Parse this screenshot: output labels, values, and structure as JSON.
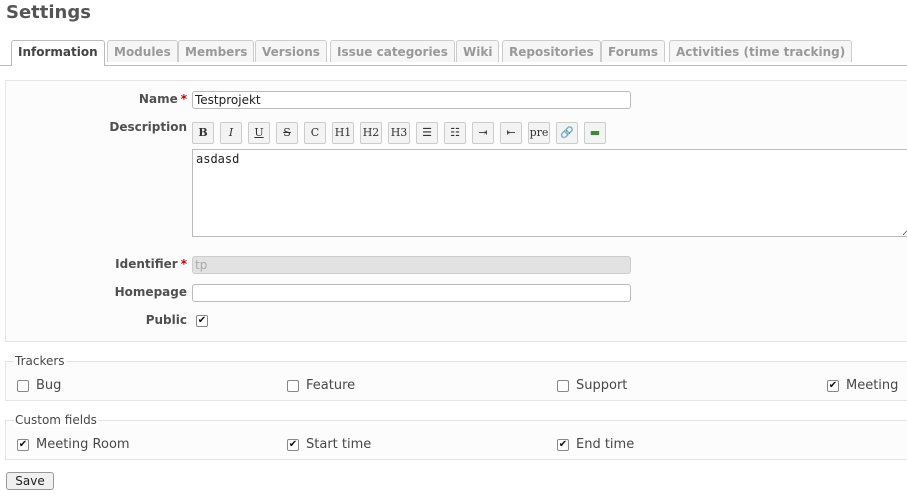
{
  "page": {
    "title": "Settings"
  },
  "tabs": [
    {
      "label": "Information",
      "active": true
    },
    {
      "label": "Modules"
    },
    {
      "label": "Members"
    },
    {
      "label": "Versions"
    },
    {
      "label": "Issue categories"
    },
    {
      "label": "Wiki"
    },
    {
      "label": "Repositories"
    },
    {
      "label": "Forums"
    },
    {
      "label": "Activities (time tracking)"
    }
  ],
  "form": {
    "name_label": "Name",
    "name_value": "Testprojekt",
    "required_mark": "*",
    "description_label": "Description",
    "description_value": "asdasd",
    "identifier_label": "Identifier",
    "identifier_value": "tp",
    "homepage_label": "Homepage",
    "homepage_value": "",
    "public_label": "Public",
    "public_checked": true
  },
  "toolbar": {
    "buttons": [
      {
        "icon": "bold-icon",
        "glyph": "B"
      },
      {
        "icon": "italic-icon",
        "glyph": "I"
      },
      {
        "icon": "underline-icon",
        "glyph": "U"
      },
      {
        "icon": "strikethrough-icon",
        "glyph": "S"
      },
      {
        "icon": "code-icon",
        "glyph": "C"
      },
      {
        "icon": "heading1-icon",
        "glyph": "H1"
      },
      {
        "icon": "heading2-icon",
        "glyph": "H2"
      },
      {
        "icon": "heading3-icon",
        "glyph": "H3"
      },
      {
        "icon": "unordered-list-icon",
        "glyph": "☰"
      },
      {
        "icon": "ordered-list-icon",
        "glyph": "☷"
      },
      {
        "icon": "quote-icon",
        "glyph": "⇥"
      },
      {
        "icon": "unquote-icon",
        "glyph": "⇤"
      },
      {
        "icon": "pre-icon",
        "glyph": "pre"
      },
      {
        "icon": "link-icon",
        "glyph": "🔗"
      },
      {
        "icon": "image-icon",
        "glyph": "▬"
      }
    ]
  },
  "trackers": {
    "legend": "Trackers",
    "items": [
      {
        "label": "Bug",
        "checked": false
      },
      {
        "label": "Feature",
        "checked": false
      },
      {
        "label": "Support",
        "checked": false
      },
      {
        "label": "Meeting",
        "checked": true
      }
    ]
  },
  "custom_fields": {
    "legend": "Custom fields",
    "items": [
      {
        "label": "Meeting Room",
        "checked": true
      },
      {
        "label": "Start time",
        "checked": true
      },
      {
        "label": "End time",
        "checked": true
      }
    ]
  },
  "actions": {
    "save_label": "Save"
  }
}
